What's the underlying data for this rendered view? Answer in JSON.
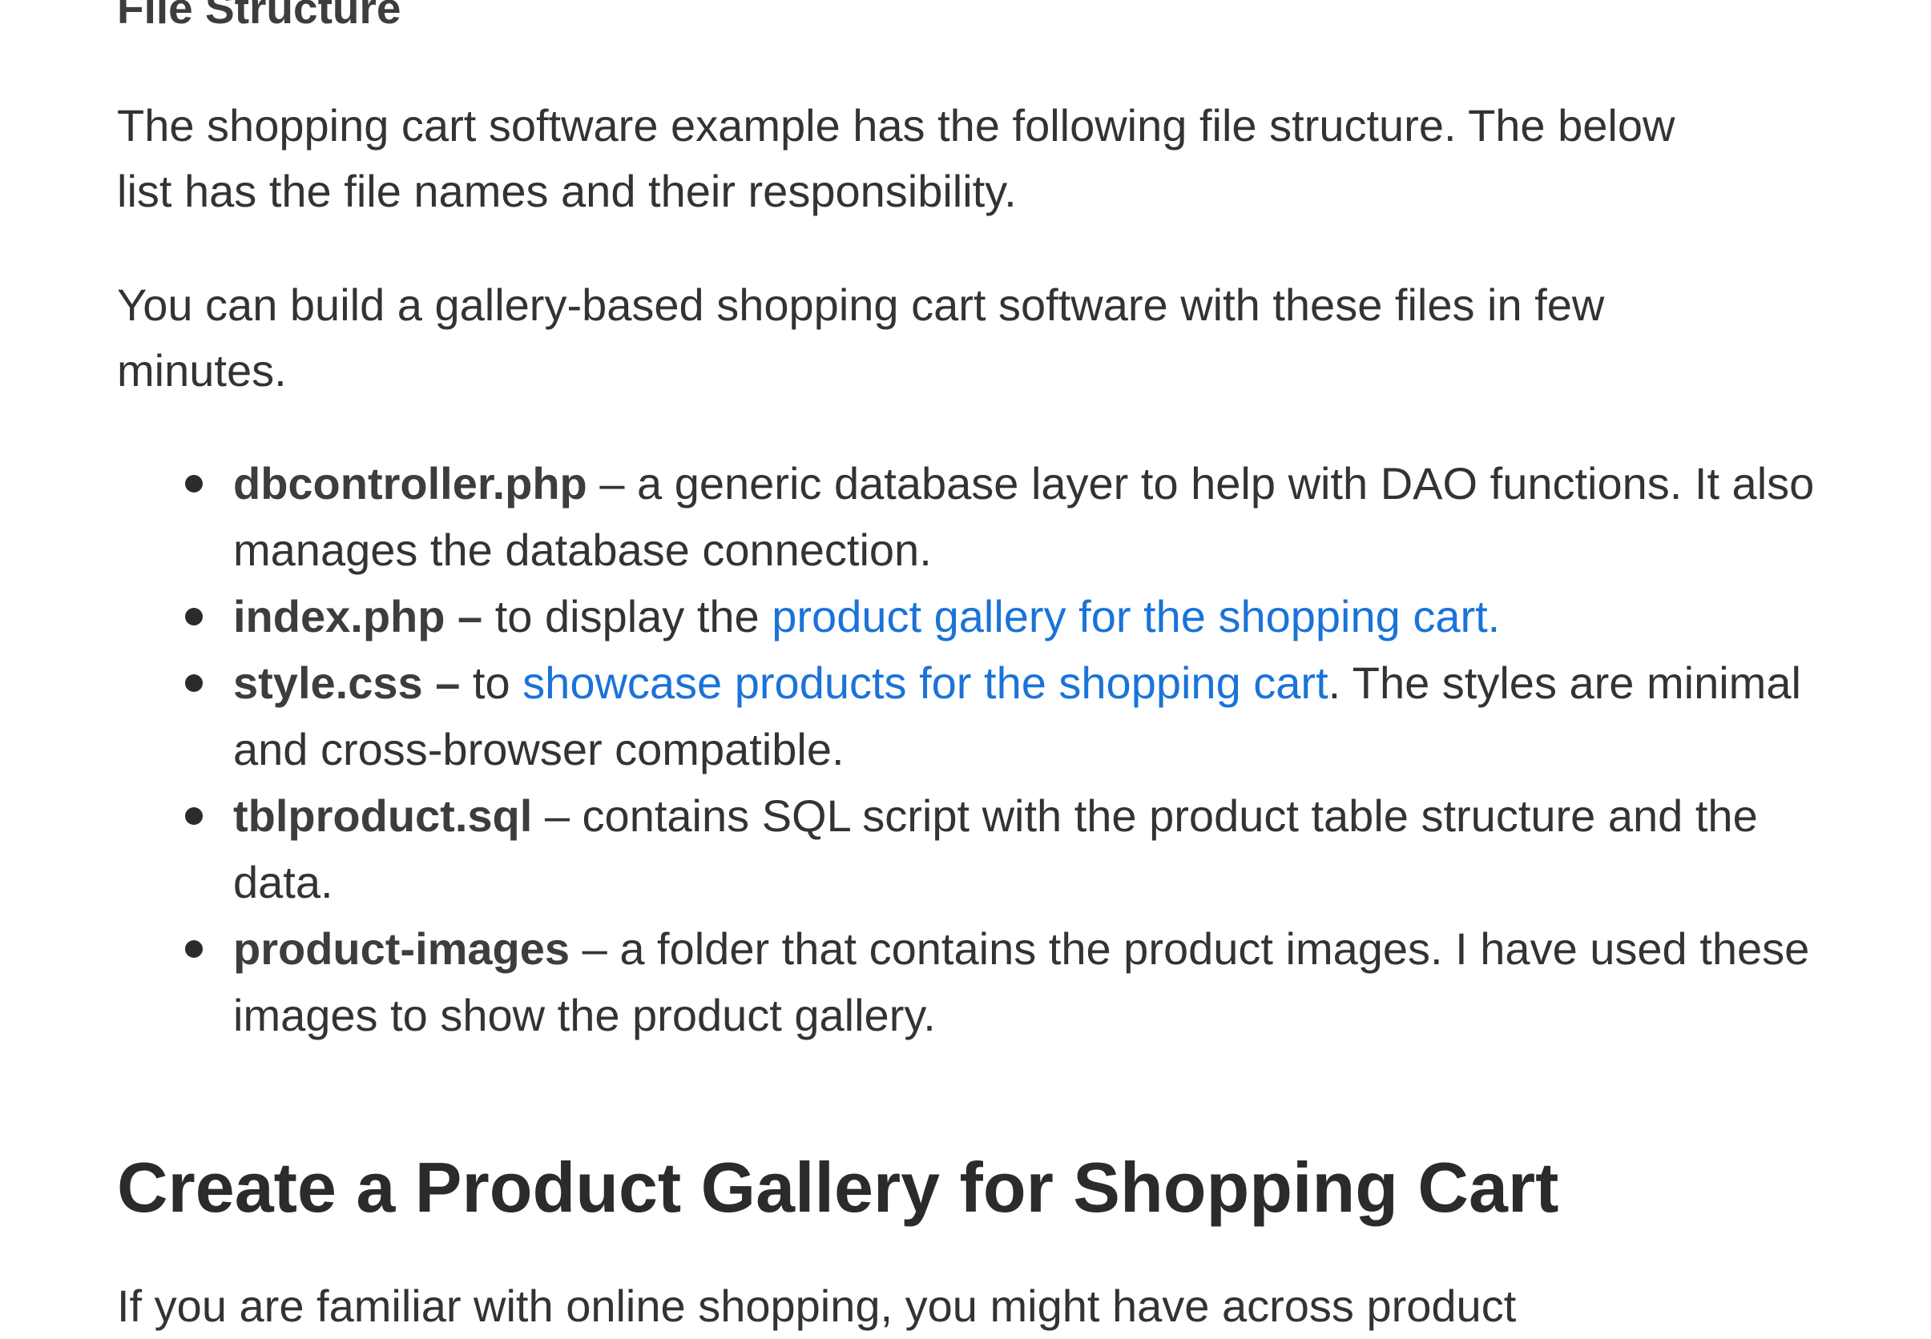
{
  "article": {
    "section_heading": "File Structure",
    "intro_paragraph": "The shopping cart software example has the following file structure. The below list has the file names and their responsibility.",
    "second_paragraph": "You can build a gallery-based shopping cart software with these files in few minutes.",
    "files": [
      {
        "name": "dbcontroller.php",
        "desc_before": " – a generic database layer to help with DAO functions. It also manages the database connection.",
        "link_text": "",
        "desc_after": ""
      },
      {
        "name": "index.php –",
        "desc_before": " to display the ",
        "link_text": "product gallery for the shopping cart.",
        "desc_after": ""
      },
      {
        "name": "style.css –",
        "desc_before": " to ",
        "link_text": "showcase products for the shopping cart",
        "desc_after": ". The styles are minimal and cross-browser compatible."
      },
      {
        "name": "tblproduct.sql",
        "desc_before": " – contains SQL script with the product table structure and the data.",
        "link_text": "",
        "desc_after": ""
      },
      {
        "name": "product-images",
        "desc_before": " – a folder that contains the product images. I have used these images to show the product gallery.",
        "link_text": "",
        "desc_after": ""
      }
    ],
    "main_heading": "Create a Product Gallery for Shopping Cart",
    "third_paragraph": "If you are familiar with online shopping, you might have across product"
  },
  "colors": {
    "text": "#333333",
    "link": "#1a73d9",
    "heading": "#2b2b2b"
  }
}
